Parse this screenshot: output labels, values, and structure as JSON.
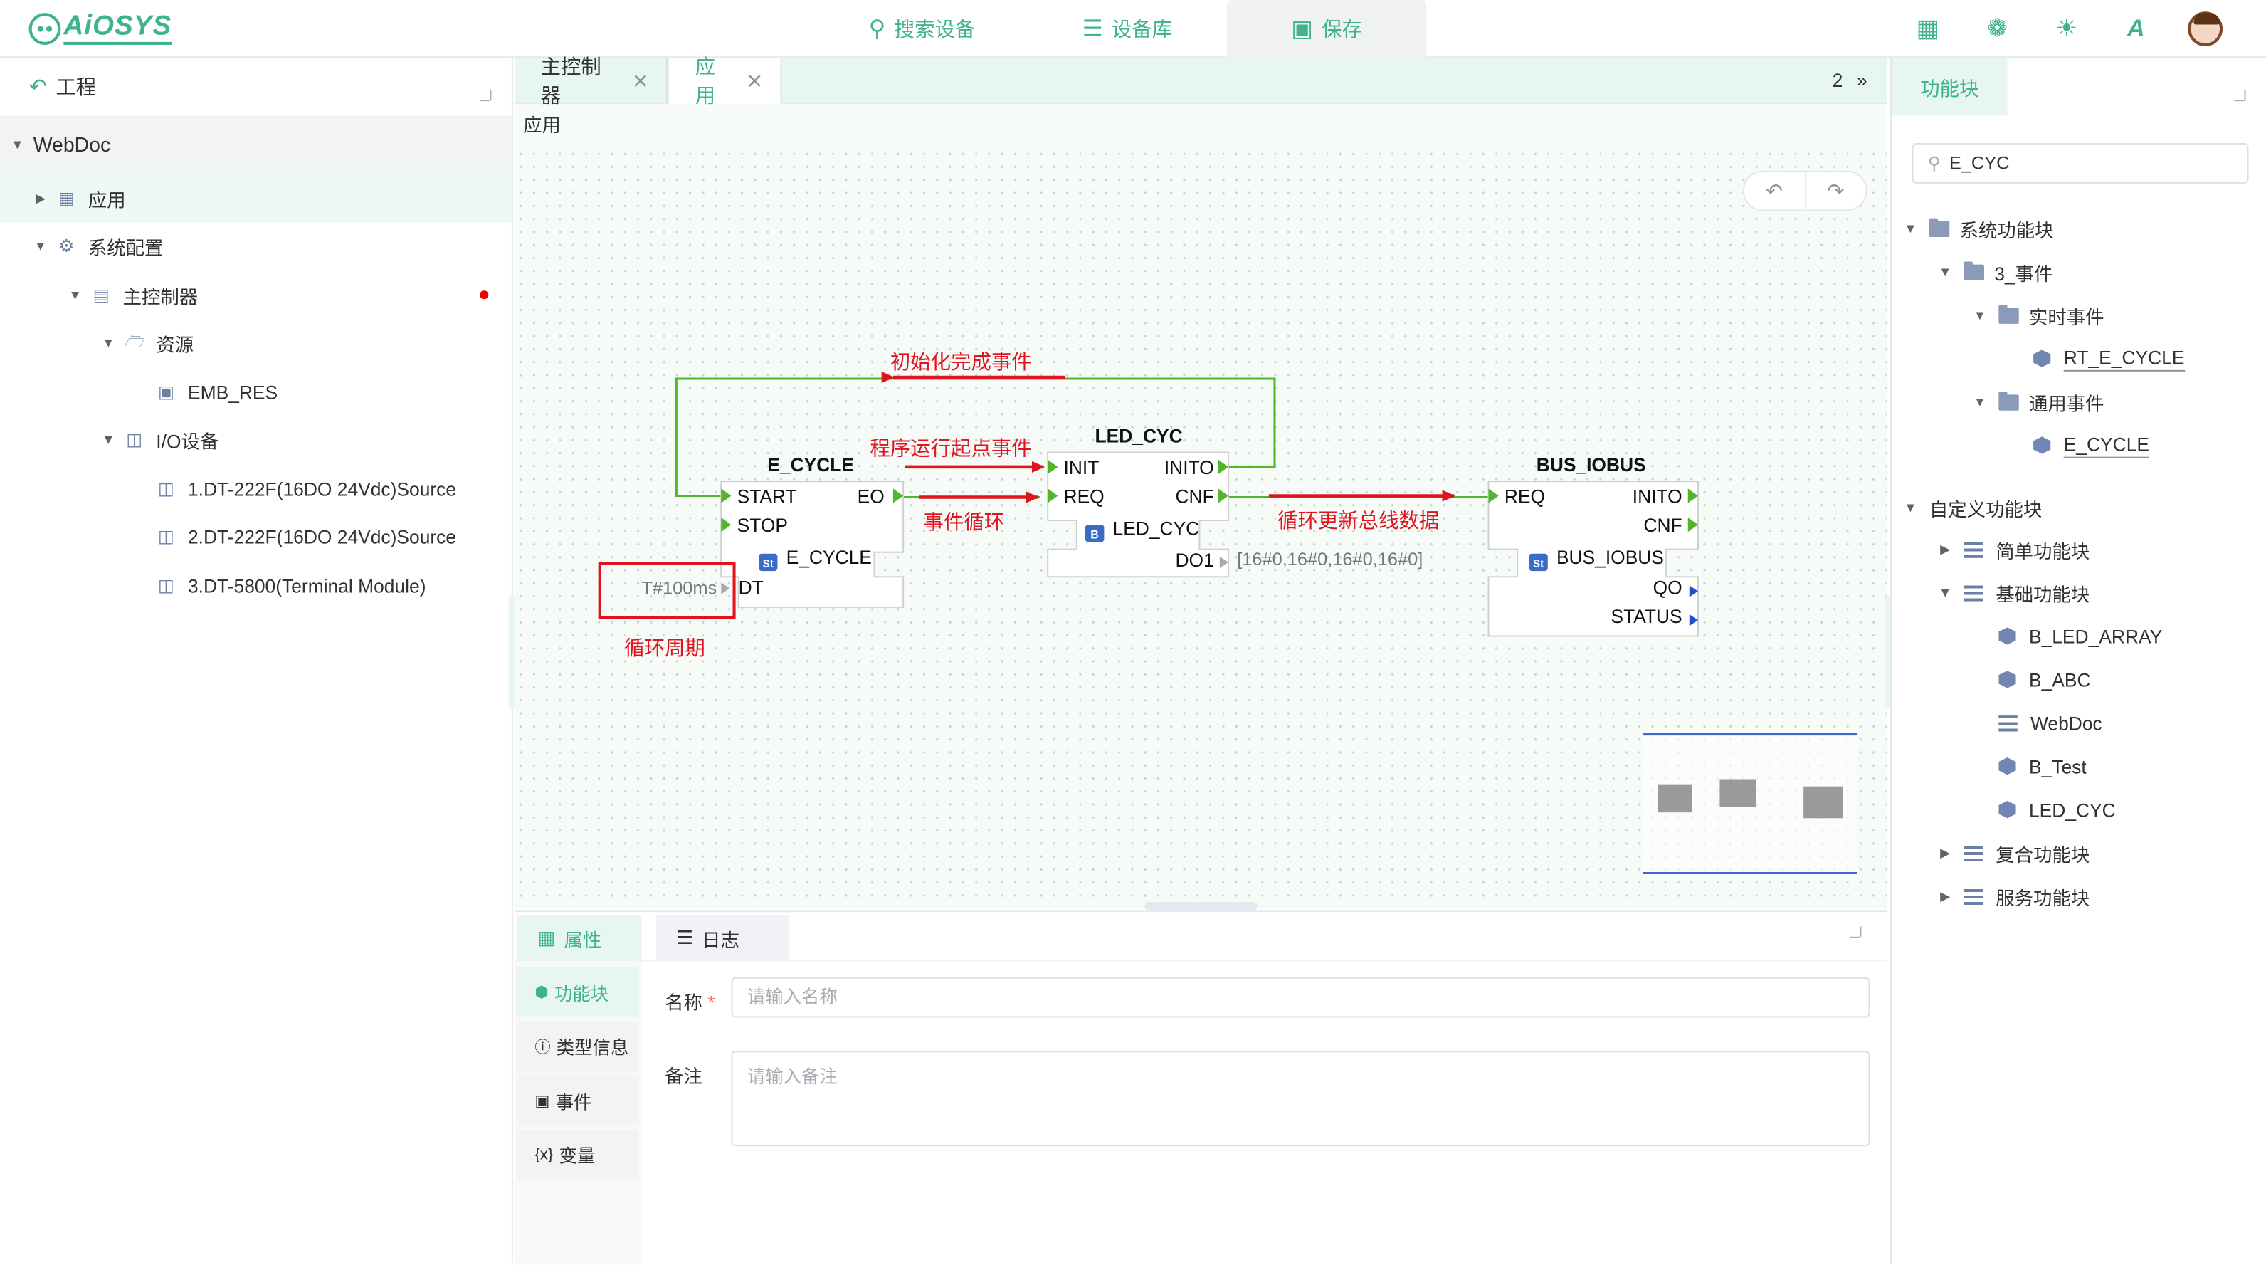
{
  "app": {
    "logo": "AiOSYS"
  },
  "topnav": {
    "search": "搜索设备",
    "library": "设备库",
    "save": "保存"
  },
  "project": {
    "header": "工程",
    "root": "WebDoc",
    "items": [
      {
        "label": "应用",
        "icon": "app-grid-icon"
      },
      {
        "label": "系统配置",
        "icon": "gear-icon"
      },
      {
        "label": "主控制器",
        "icon": "controller-icon"
      },
      {
        "label": "资源",
        "icon": "folder-icon"
      },
      {
        "label": "EMB_RES",
        "icon": "resource-icon"
      },
      {
        "label": "I/O设备",
        "icon": "io-icon"
      },
      {
        "label": "1.DT-222F(16DO 24Vdc)Source",
        "icon": "module-icon"
      },
      {
        "label": "2.DT-222F(16DO 24Vdc)Source",
        "icon": "module-icon"
      },
      {
        "label": "3.DT-5800(Terminal Module)",
        "icon": "module-icon"
      }
    ]
  },
  "editor": {
    "tabs": [
      {
        "label": "主控制器"
      },
      {
        "label": "应用"
      }
    ],
    "tab_count": "2",
    "breadcrumb": "应用"
  },
  "diagram": {
    "blocks": [
      {
        "name": "E_CYCLE",
        "inputs": [
          "START",
          "STOP"
        ],
        "outputs": [
          "EO"
        ],
        "type_badge": "St",
        "type_name": "E_CYCLE",
        "data_inputs": [
          "DT"
        ],
        "data_outputs": []
      },
      {
        "name": "LED_CYC",
        "inputs": [
          "INIT",
          "REQ"
        ],
        "outputs": [
          "INITO",
          "CNF"
        ],
        "type_badge": "B",
        "type_name": "LED_CYC",
        "data_inputs": [],
        "data_outputs": [
          "DO1"
        ]
      },
      {
        "name": "BUS_IOBUS",
        "inputs": [
          "REQ"
        ],
        "outputs": [
          "INITO",
          "CNF"
        ],
        "type_badge": "St",
        "type_name": "BUS_IOBUS",
        "data_inputs": [],
        "data_outputs": [
          "QO",
          "STATUS"
        ]
      }
    ],
    "param_dt": "T#100ms",
    "param_do1": "[16#0,16#0,16#0,16#0]",
    "annotations": {
      "init_done": "初始化完成事件",
      "program_start": "程序运行起点事件",
      "event_loop": "事件循环",
      "bus_update": "循环更新总线数据",
      "cycle_period": "循环周期"
    },
    "colors": {
      "event_wire": "#52b62a",
      "annotation": "#e0141e"
    }
  },
  "bottom": {
    "tabs": [
      {
        "label": "属性"
      },
      {
        "label": "日志"
      }
    ],
    "menu": [
      {
        "label": "功能块"
      },
      {
        "label": "类型信息"
      },
      {
        "label": "事件"
      },
      {
        "label": "变量"
      }
    ],
    "form": {
      "name_label": "名称",
      "name_required": "*",
      "name_placeholder": "请输入名称",
      "note_label": "备注",
      "note_placeholder": "请输入备注"
    }
  },
  "library": {
    "tab": "功能块",
    "search_value": "E_CYC",
    "tree": {
      "system": "系统功能块",
      "events": "3_事件",
      "realtime": "实时事件",
      "rt_e_cycle": "RT_E_CYCLE",
      "general": "通用事件",
      "e_cycle": "E_CYCLE",
      "custom": "自定义功能块",
      "simple": "简单功能块",
      "basic": "基础功能块",
      "b_led_array": "B_LED_ARRAY",
      "b_abc": "B_ABC",
      "webdoc": "WebDoc",
      "b_test": "B_Test",
      "led_cyc": "LED_CYC",
      "composite": "复合功能块",
      "service": "服务功能块"
    }
  },
  "accent_color": "#3fb38a"
}
